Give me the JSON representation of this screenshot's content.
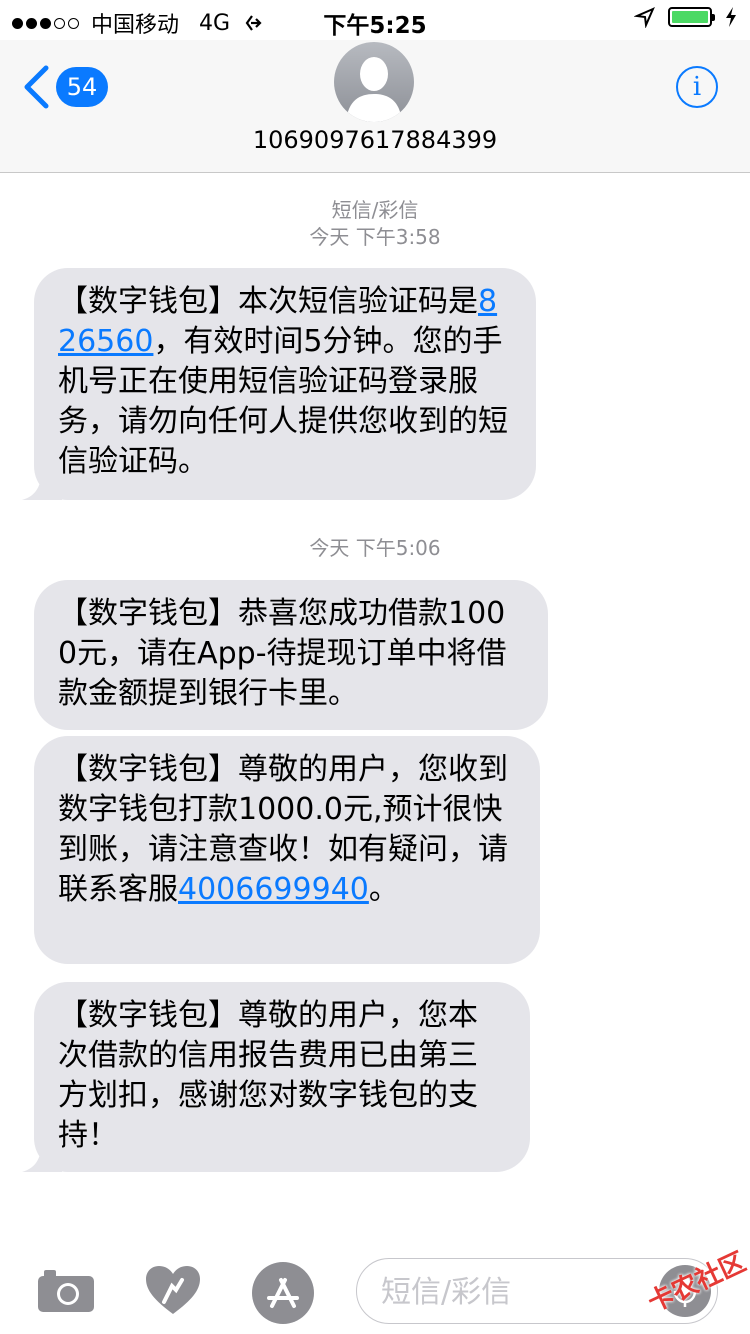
{
  "status_bar": {
    "carrier": "中国移动",
    "network": "4G",
    "time": "下午5:25",
    "signal_bars": 3,
    "signal_total": 5,
    "battery_level": 1.0
  },
  "header": {
    "back_count": "54",
    "contact_number": "1069097617884399",
    "info_glyph": "i"
  },
  "conversation": {
    "service_label": "短信/彩信",
    "groups": [
      {
        "timestamp": "今天 下午3:58",
        "messages": [
          {
            "parts": [
              "【数字钱包】本次短信验证码是",
              "826560",
              "，有效时间5分钟。您的手机号正在使用短信验证码登录服务，请勿向任何人提供您收到的短信验证码。"
            ]
          }
        ]
      },
      {
        "timestamp": "今天 下午5:06",
        "messages": [
          {
            "text": "【数字钱包】恭喜您成功借款1000元，请在App-待提现订单中将借款金额提到银行卡里。"
          },
          {
            "parts": [
              "【数字钱包】尊敬的用户，您收到数字钱包打款1000.0元,预计很快到账，请注意查收！如有疑问，请联系客服",
              "4006699940",
              "。"
            ]
          },
          {
            "text": "【数字钱包】尊敬的用户，您本次借款的信用报告费用已由第三方划扣，感谢您对数字钱包的支持！"
          }
        ]
      }
    ]
  },
  "composer": {
    "placeholder": "短信/彩信"
  },
  "watermark": "卡农社区",
  "colors": {
    "accent": "#0a7aff",
    "bubble": "#e5e5ea",
    "meta_text": "#8e8e93",
    "battery": "#4cd964"
  }
}
